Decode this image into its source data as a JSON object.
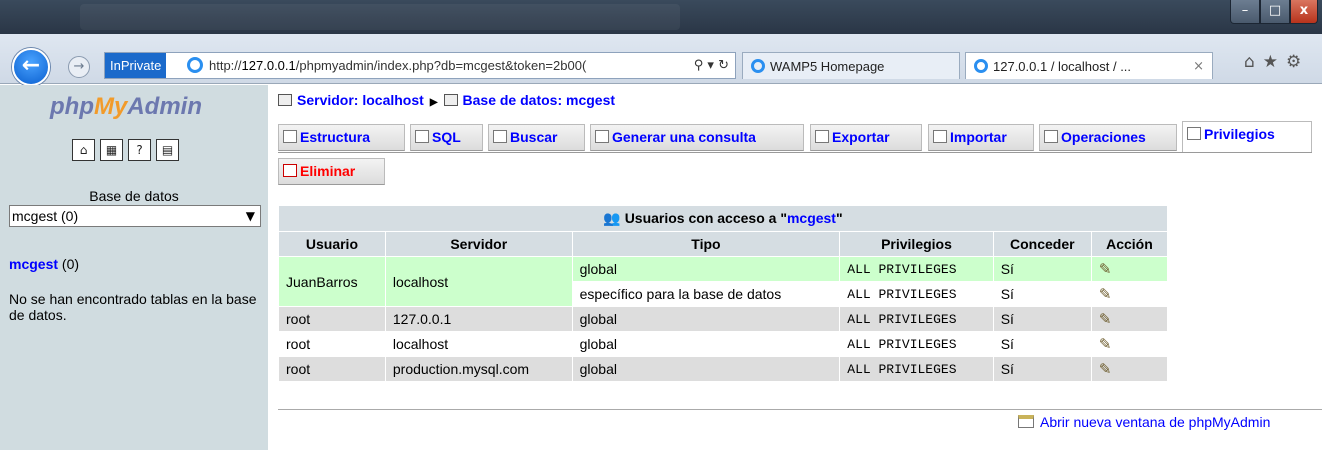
{
  "browser": {
    "inprivate_label": "InPrivate",
    "url_prefix": "http://",
    "url_host": "127.0.0.1",
    "url_rest": "/phpmyadmin/index.php?db=mcgest&token=2b00(",
    "addr_tools": "⚲ ▾ ↻",
    "tabs": [
      {
        "label": "WAMP5 Homepage"
      },
      {
        "label": "127.0.0.1 / localhost / ...",
        "close": "×"
      }
    ],
    "right_tools": "⌂★⚙",
    "window_buttons": {
      "min": "–",
      "max": "□",
      "close": "x"
    },
    "back": "←",
    "forward": "→"
  },
  "sidebar": {
    "logo": {
      "php": "php",
      "my": "My",
      "admin": "Admin"
    },
    "icons": [
      "⌂",
      "▦",
      "?",
      "▤"
    ],
    "db_label": "Base de datos",
    "db_select": "mcgest (0)",
    "db_link": "mcgest",
    "db_link_count": "(0)",
    "no_tables": "No se han encontrado tablas en la base de datos."
  },
  "breadcrumb": {
    "server": "Servidor: localhost",
    "database": "Base de datos: mcgest"
  },
  "tabs": {
    "estructura": "Estructura",
    "sql": "SQL",
    "buscar": "Buscar",
    "generar": "Generar una consulta",
    "exportar": "Exportar",
    "importar": "Importar",
    "operaciones": "Operaciones",
    "privilegios": "Privilegios",
    "eliminar": "Eliminar"
  },
  "privileges": {
    "caption_prefix": "Usuarios con acceso a \"",
    "caption_db": "mcgest",
    "caption_suffix": "\"",
    "headers": [
      "Usuario",
      "Servidor",
      "Tipo",
      "Privilegios",
      "Conceder",
      "Acción"
    ],
    "rows": [
      {
        "usuario": "JuanBarros",
        "servidor": "localhost",
        "tipo": "global",
        "privilegios": "ALL PRIVILEGES",
        "conceder": "Sí"
      },
      {
        "tipo": "específico para la base de datos",
        "privilegios": "ALL PRIVILEGES",
        "conceder": "Sí"
      },
      {
        "usuario": "root",
        "servidor": "127.0.0.1",
        "tipo": "global",
        "privilegios": "ALL PRIVILEGES",
        "conceder": "Sí"
      },
      {
        "usuario": "root",
        "servidor": "localhost",
        "tipo": "global",
        "privilegios": "ALL PRIVILEGES",
        "conceder": "Sí"
      },
      {
        "usuario": "root",
        "servidor": "production.mysql.com",
        "tipo": "global",
        "privilegios": "ALL PRIVILEGES",
        "conceder": "Sí"
      }
    ],
    "edit_icon": "✎"
  },
  "new_window_link": "Abrir nueva ventana de phpMyAdmin"
}
